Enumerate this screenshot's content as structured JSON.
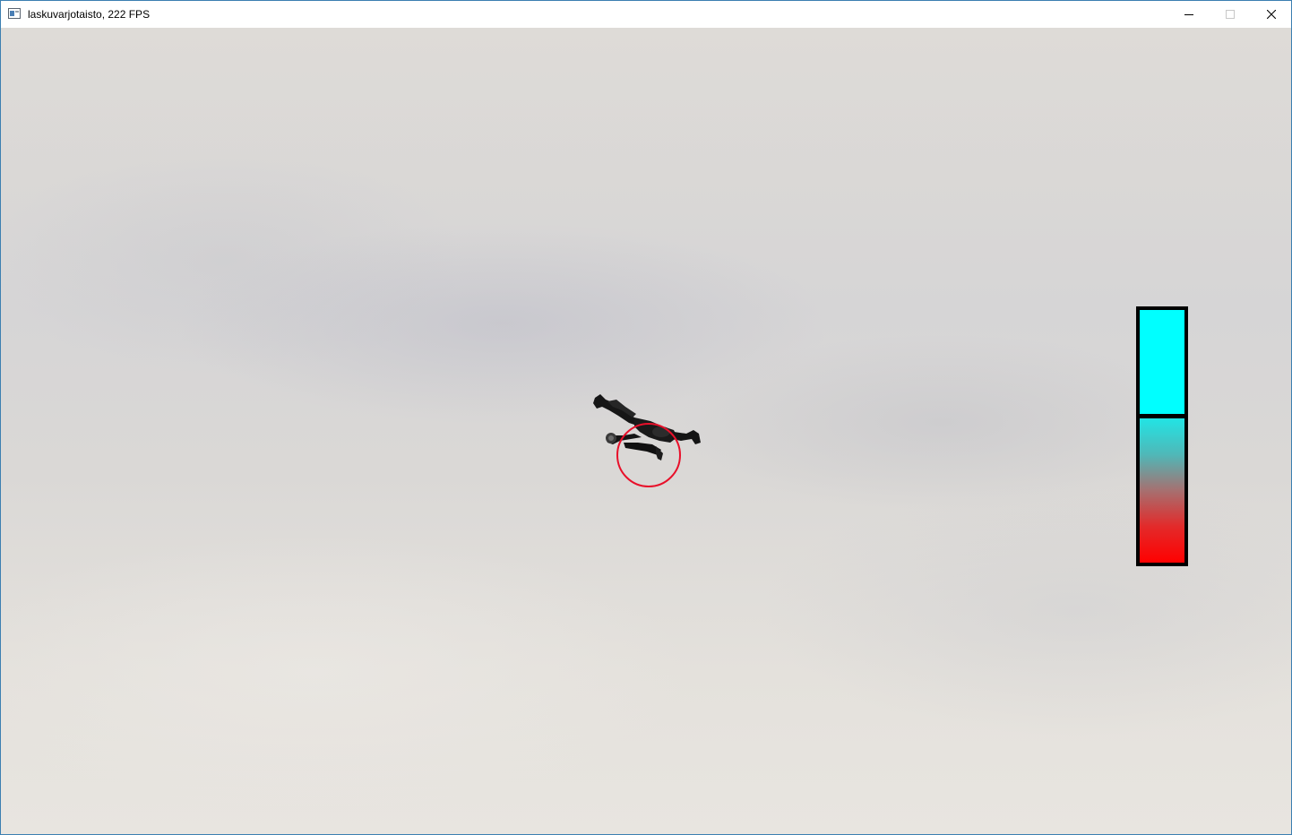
{
  "window": {
    "title": "laskuvarjotaisto, 222 FPS",
    "app_icon": "window-app-icon",
    "controls": {
      "minimize_icon": "minimize-icon",
      "maximize_icon": "maximize-icon",
      "close_icon": "close-icon"
    }
  },
  "scene": {
    "background": "cloudy-sky",
    "player": "skydiver-freefall",
    "target_ring_color": "#e8102a"
  },
  "gauge": {
    "top_color": "#00ffff",
    "bottom_gradient": [
      "#22e4e4",
      "#ff0000"
    ],
    "border_color": "#000000"
  }
}
